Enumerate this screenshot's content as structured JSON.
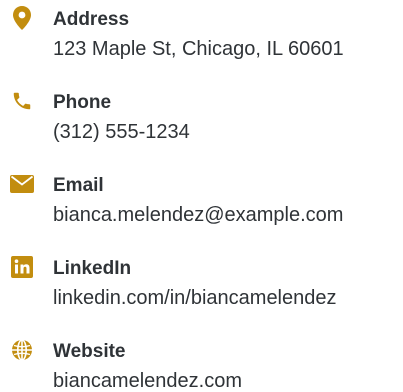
{
  "accent_color": "#c28d0f",
  "text_color": "#2f3337",
  "contacts": [
    {
      "icon": "map-pin-icon",
      "label": "Address",
      "value": "123 Maple St, Chicago, IL 60601"
    },
    {
      "icon": "phone-icon",
      "label": "Phone",
      "value": "(312) 555-1234"
    },
    {
      "icon": "envelope-icon",
      "label": "Email",
      "value": "bianca.melendez@example.com"
    },
    {
      "icon": "linkedin-icon",
      "label": "LinkedIn",
      "value": "linkedin.com/in/biancamelendez"
    },
    {
      "icon": "globe-icon",
      "label": "Website",
      "value": "biancamelendez.com"
    }
  ]
}
